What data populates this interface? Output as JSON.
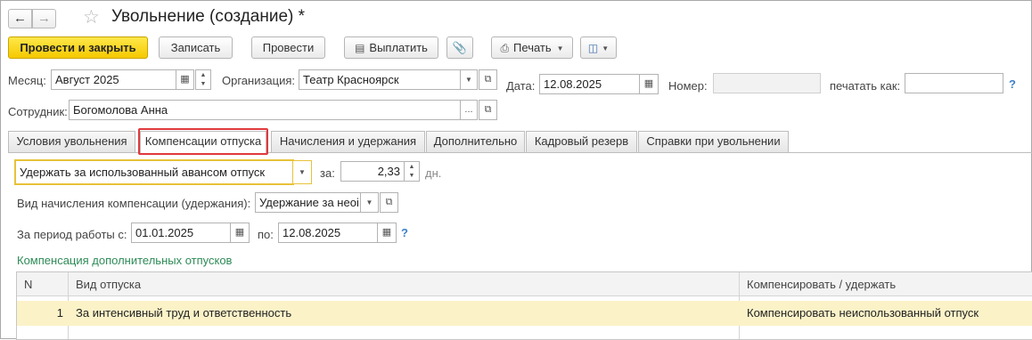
{
  "header": {
    "back_icon": "arrow-left-icon",
    "forward_icon": "arrow-right-icon",
    "favorite_icon": "star-icon",
    "title": "Увольнение (создание) *"
  },
  "toolbar": {
    "post_close_label": "Провести и закрыть",
    "save_label": "Записать",
    "post_label": "Провести",
    "pay_label": "Выплатить",
    "attach_icon": "paperclip-icon",
    "print_label": "Печать",
    "more_icon": "document-export-icon"
  },
  "form": {
    "month_label": "Месяц:",
    "month_value": "Август 2025",
    "org_label": "Организация:",
    "org_value": "Театр Красноярск",
    "date_label": "Дата:",
    "date_value": "12.08.2025",
    "number_label": "Номер:",
    "number_value": "",
    "print_as_label": "печатать как:",
    "print_as_value": "",
    "help": "?",
    "employee_label": "Сотрудник:",
    "employee_value": "Богомолова Анна"
  },
  "tabs": [
    {
      "label": "Условия увольнения"
    },
    {
      "label": "Компенсации отпуска"
    },
    {
      "label": "Начисления и удержания"
    },
    {
      "label": "Дополнительно"
    },
    {
      "label": "Кадровый резерв"
    },
    {
      "label": "Справки при увольнении"
    }
  ],
  "compensation": {
    "mode_value": "Удержать за использованный авансом отпуск",
    "for_label": "за:",
    "days_value": "2,33",
    "days_unit": "дн.",
    "accrual_type_label": "Вид начисления компенсации (удержания):",
    "accrual_type_value": "Удержание за неоі",
    "period_label": "За период работы с:",
    "period_from": "01.01.2025",
    "period_to_label": "по:",
    "period_to": "12.08.2025",
    "help": "?"
  },
  "additional": {
    "section_title": "Компенсация дополнительных отпусков",
    "columns": [
      "N",
      "Вид отпуска",
      "Компенсировать / удержать"
    ],
    "rows": [
      {
        "n": "1",
        "type": "За интенсивный труд и ответственность",
        "action": "Компенсировать неиспользованный отпуск"
      }
    ]
  },
  "colors": {
    "primary_button": "#f5c900",
    "tab_highlight": "#e0393e",
    "section_title": "#2e8b57",
    "selected_row": "#fbf2c8",
    "help": "#3f80c8",
    "focus_border": "#e8c23a"
  }
}
